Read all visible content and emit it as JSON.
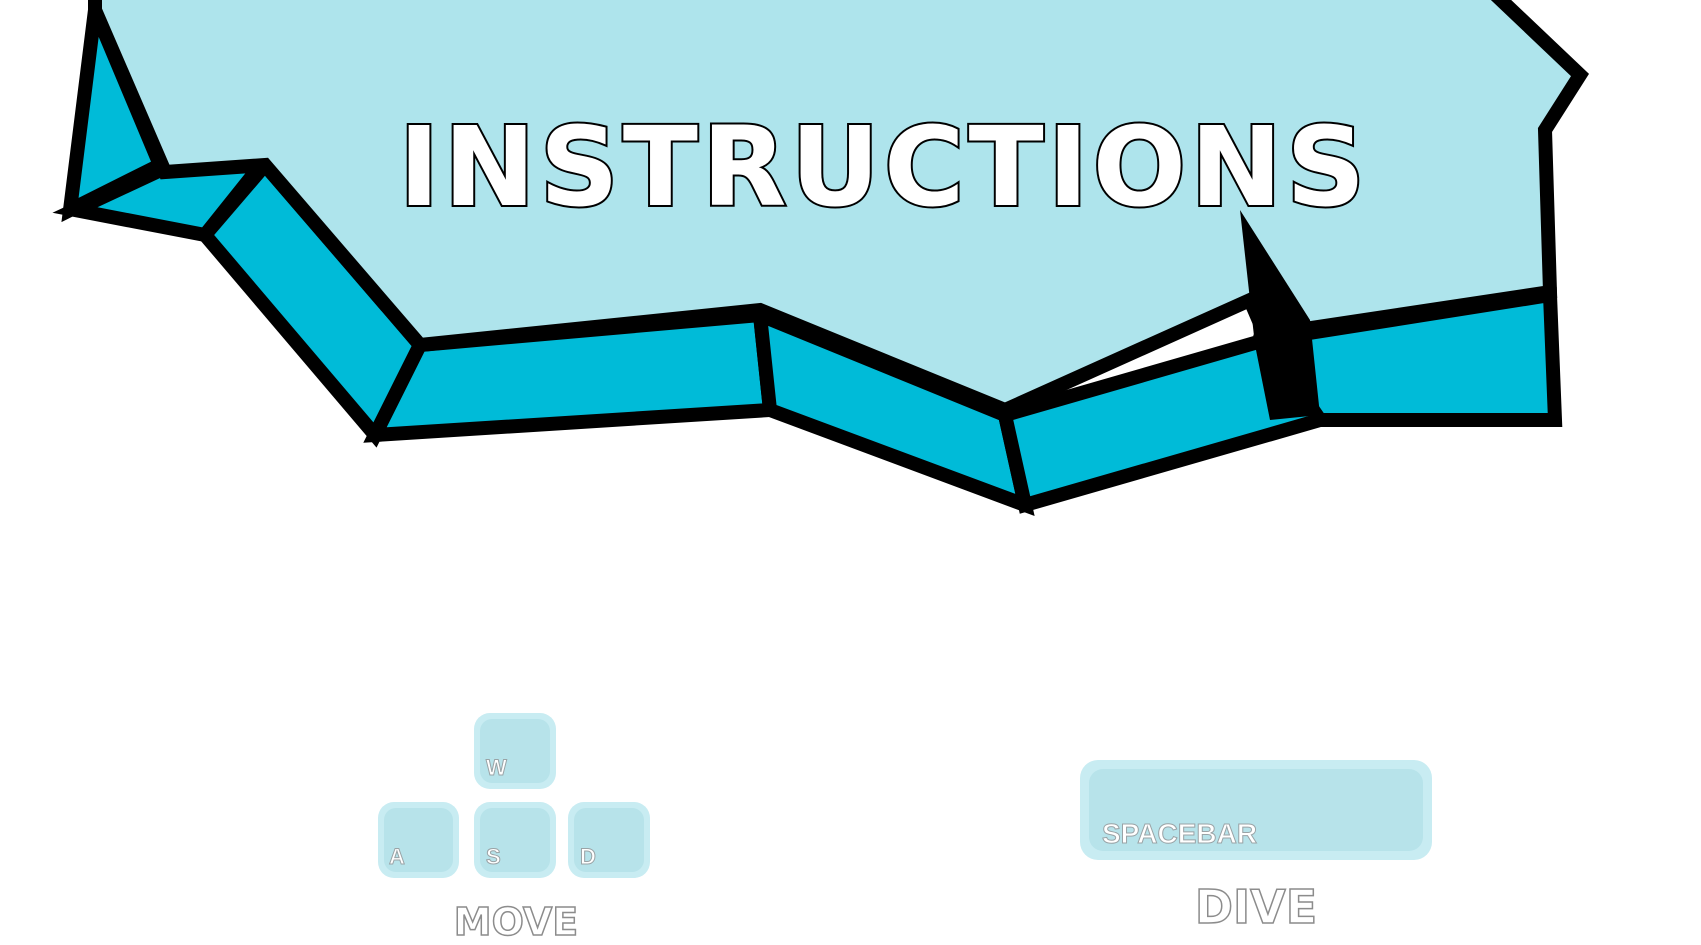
{
  "screen": {
    "title": "INSTRUCTIONS"
  },
  "controls": {
    "move": {
      "caption": "MOVE",
      "keys": {
        "up": "W",
        "left": "A",
        "down": "S",
        "right": "D"
      }
    },
    "dive": {
      "caption": "DIVE",
      "key": "SPACEBAR"
    }
  },
  "colors": {
    "ice_top": "#aee4ec",
    "ice_side": "#00bbd8",
    "outline": "#000000",
    "key_outer": "#c8ecf2",
    "key_inner": "#b7e3ea"
  }
}
